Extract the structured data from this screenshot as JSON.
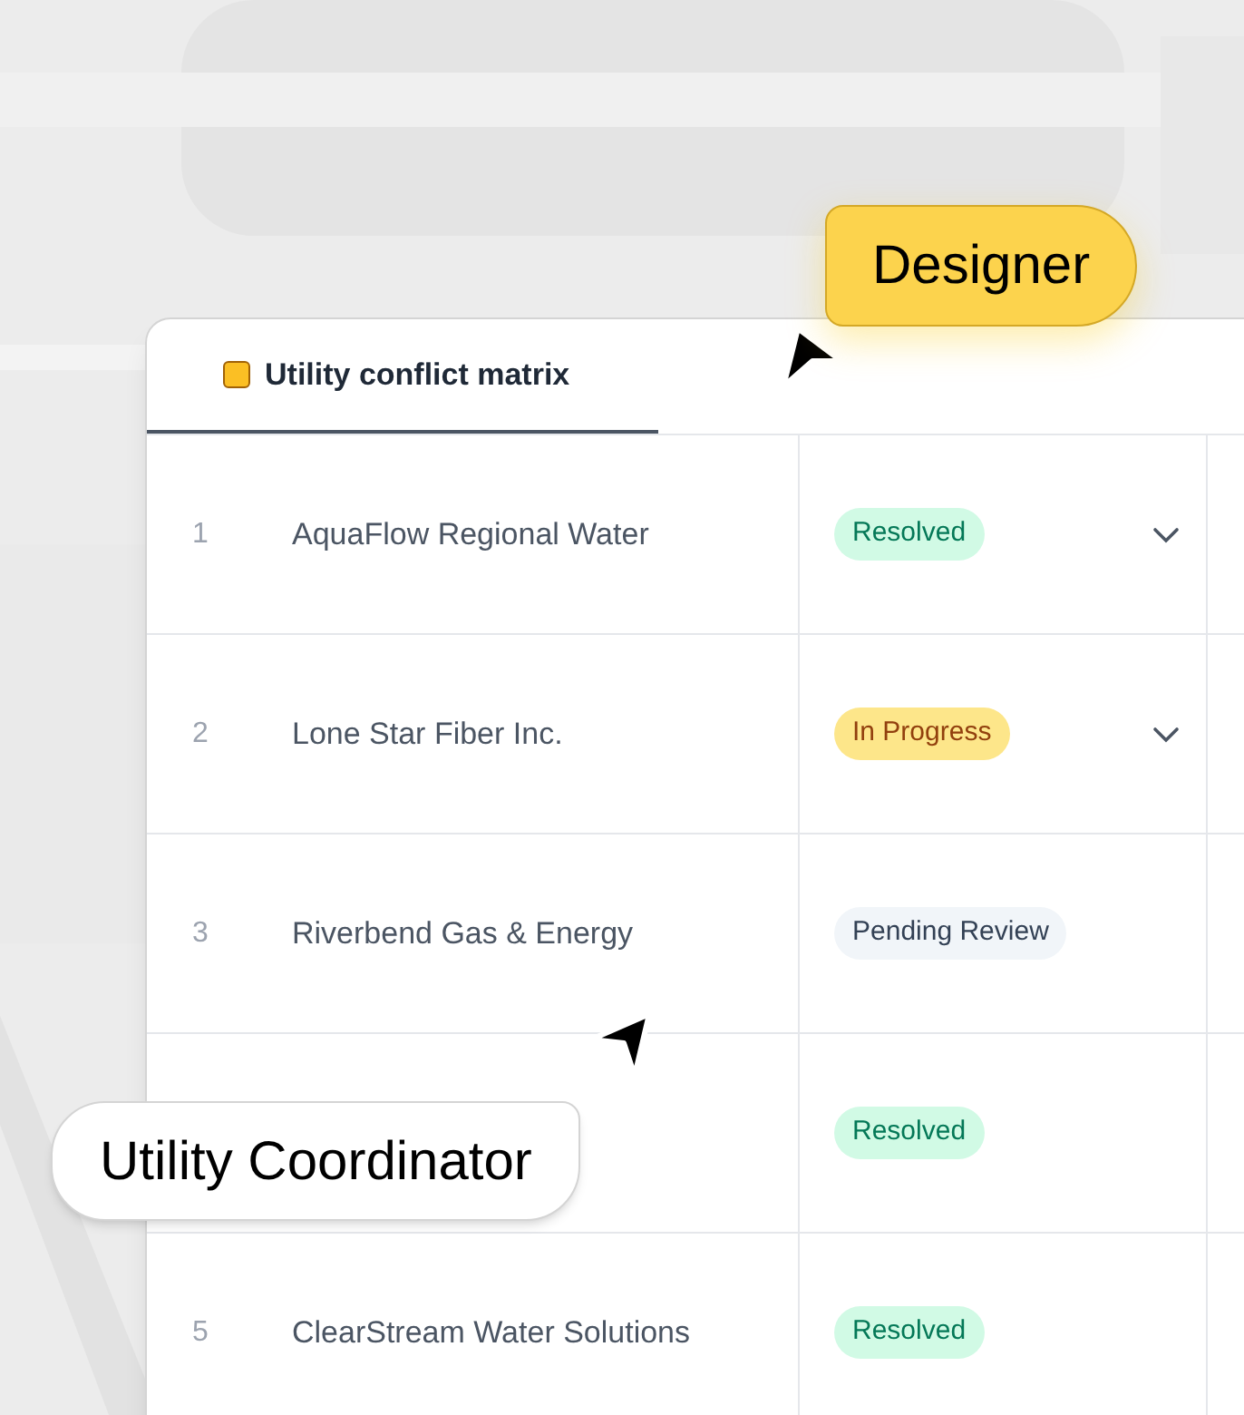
{
  "tab": {
    "label": "Utility conflict matrix",
    "color": "#fbbf24",
    "selected": true
  },
  "rows": [
    {
      "number": "1",
      "name": "AquaFlow Regional Water",
      "status": {
        "label": "Resolved",
        "kind": "success"
      },
      "dropdown": true
    },
    {
      "number": "2",
      "name": "Lone Star Fiber Inc.",
      "status": {
        "label": "In Progress",
        "kind": "warning"
      },
      "dropdown": true
    },
    {
      "number": "3",
      "name": "Riverbend Gas & Energy",
      "status": {
        "label": "Pending Review",
        "kind": "neutral"
      },
      "dropdown": false
    },
    {
      "status": {
        "label": "Resolved",
        "kind": "success"
      },
      "dropdown": false
    },
    {
      "number": "5",
      "name": "ClearStream Water Solutions",
      "status": {
        "label": "Resolved",
        "kind": "success"
      },
      "dropdown": false
    }
  ],
  "cursors": [
    {
      "label": "Designer",
      "kind": "designer"
    },
    {
      "label": "Utility Coordinator",
      "kind": "coordinator"
    }
  ]
}
